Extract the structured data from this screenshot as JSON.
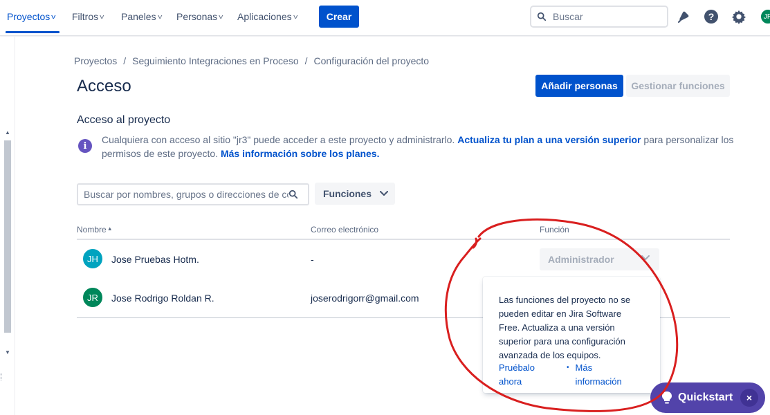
{
  "topnav": {
    "items": [
      {
        "label": "Proyectos"
      },
      {
        "label": "Filtros"
      },
      {
        "label": "Paneles"
      },
      {
        "label": "Personas"
      },
      {
        "label": "Aplicaciones"
      }
    ],
    "create_label": "Crear",
    "search_placeholder": "Buscar",
    "avatar_initials": "JR"
  },
  "breadcrumb": [
    "Proyectos",
    "Seguimiento Integraciones en Proceso",
    "Configuración del proyecto"
  ],
  "page": {
    "title": "Acceso",
    "add_people_label": "Añadir personas",
    "manage_roles_label": "Gestionar funciones"
  },
  "project_access": {
    "title": "Acceso al proyecto",
    "info_prefix": "Cualquiera con acceso al sitio \"jr3\" puede acceder a este proyecto y administrarlo. ",
    "info_link1": "Actualiza tu plan a una versión superior",
    "info_middle": " para personalizar los permisos de este proyecto. ",
    "info_link2": "Más información sobre los planes."
  },
  "filters": {
    "search_placeholder": "Buscar por nombres, grupos o direcciones de correo electrónico",
    "roles_label": "Funciones"
  },
  "table": {
    "headers": {
      "name": "Nombre",
      "email": "Correo electrónico",
      "role": "Función"
    },
    "rows": [
      {
        "initials": "JH",
        "name": "Jose Pruebas Hotm.",
        "email": "-",
        "role": "Administrador",
        "avatar_color": "#00a3bf"
      },
      {
        "initials": "JR",
        "name": "Jose Rodrigo Roldan R.",
        "email": "joserodrigorr@gmail.com",
        "role": "",
        "avatar_color": "#00875a"
      }
    ]
  },
  "popup": {
    "text": "Las funciones del proyecto no se pueden editar en Jira Software Free. Actualiza a una versión superior para una configuración avanzada de los equipos.",
    "link_try": "Pruébalo ahora",
    "link_more": "Más información"
  },
  "quickstart": {
    "label": "Quickstart",
    "close": "×"
  },
  "colors": {
    "accent": "#0052cc",
    "info": "#6554c0",
    "quickstart": "#5243aa",
    "annotation": "#d91f1f"
  }
}
